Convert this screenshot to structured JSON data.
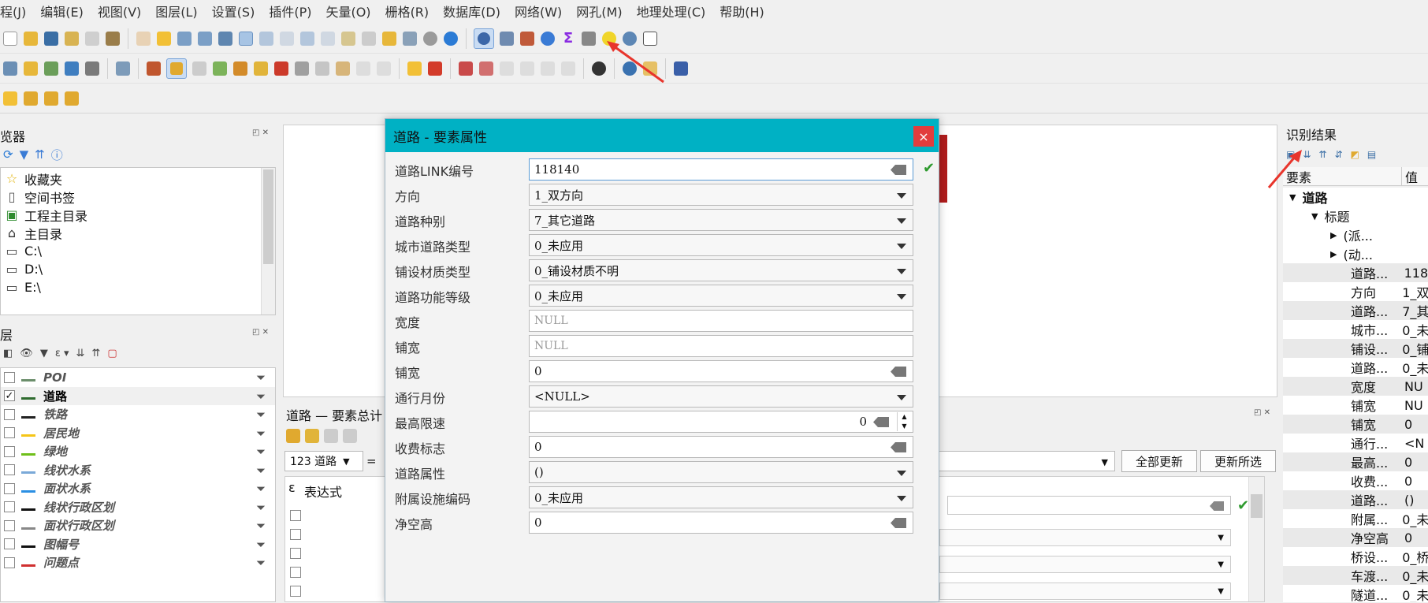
{
  "menubar": [
    "程(J)",
    "编辑(E)",
    "视图(V)",
    "图层(L)",
    "设置(S)",
    "插件(P)",
    "矢量(O)",
    "栅格(R)",
    "数据库(D)",
    "网络(W)",
    "网孔(M)",
    "地理处理(C)",
    "帮助(H)"
  ],
  "browser": {
    "title": "览器",
    "items": [
      {
        "label": "收藏夹",
        "icon": "star-icon"
      },
      {
        "label": "空间书签",
        "icon": "bookmark-icon"
      },
      {
        "label": "工程主目录",
        "icon": "project-home-icon"
      },
      {
        "label": "主目录",
        "icon": "home-icon"
      },
      {
        "label": "C:\\",
        "icon": "folder-icon"
      },
      {
        "label": "D:\\",
        "icon": "folder-icon"
      },
      {
        "label": "E:\\",
        "icon": "folder-icon"
      }
    ]
  },
  "layers": {
    "title": "层",
    "items": [
      {
        "label": "POI",
        "checked": false,
        "symbol": "#6b8e6b"
      },
      {
        "label": "道路",
        "checked": true,
        "symbol": "#2f6b2f"
      },
      {
        "label": "铁路",
        "checked": false,
        "symbol": "#222222"
      },
      {
        "label": "居民地",
        "checked": false,
        "symbol": "#f5c518"
      },
      {
        "label": "绿地",
        "checked": false,
        "symbol": "#6fbf1a"
      },
      {
        "label": "线状水系",
        "checked": false,
        "symbol": "#7aa9d8"
      },
      {
        "label": "面状水系",
        "checked": false,
        "symbol": "#2b8fe3"
      },
      {
        "label": "线状行政区划",
        "checked": false,
        "symbol": "#111111"
      },
      {
        "label": "面状行政区划",
        "checked": false,
        "symbol": "#888888"
      },
      {
        "label": "图幅号",
        "checked": false,
        "symbol": "#111111"
      },
      {
        "label": "问题点",
        "checked": false,
        "symbol": "#d03030"
      }
    ]
  },
  "dialog": {
    "title": "道路 - 要素属性",
    "close": "×",
    "fields": [
      {
        "label": "道路LINK编号",
        "value": "118140",
        "kind": "text"
      },
      {
        "label": "方向",
        "value": "1_双方向",
        "kind": "combo"
      },
      {
        "label": "道路种别",
        "value": "7_其它道路",
        "kind": "combo"
      },
      {
        "label": "城市道路类型",
        "value": "0_未应用",
        "kind": "combo"
      },
      {
        "label": "铺设材质类型",
        "value": "0_铺设材质不明",
        "kind": "combo"
      },
      {
        "label": "道路功能等级",
        "value": "0_未应用",
        "kind": "combo"
      },
      {
        "label": "宽度",
        "value": "NULL",
        "kind": "placeholder"
      },
      {
        "label": "铺宽",
        "value": "NULL",
        "kind": "placeholder"
      },
      {
        "label": "铺宽",
        "value": "0",
        "kind": "text"
      },
      {
        "label": "通行月份",
        "value": "<NULL>",
        "kind": "combo"
      },
      {
        "label": "最高限速",
        "value": "0",
        "kind": "spin"
      },
      {
        "label": "收费标志",
        "value": "0",
        "kind": "text"
      },
      {
        "label": "道路属性",
        "value": "()",
        "kind": "combo"
      },
      {
        "label": "附属设施编码",
        "value": "0_未应用",
        "kind": "combo"
      },
      {
        "label": "净空高",
        "value": "0",
        "kind": "text"
      }
    ]
  },
  "attr_table": {
    "title": "道路 — 要素总计",
    "field_combo": "123 道路",
    "eq": "=",
    "update_all": "全部更新",
    "update_selected": "更新所选",
    "expression": "表达式"
  },
  "identify": {
    "title": "识别结果",
    "col_feature": "要素",
    "col_value": "值",
    "rows": [
      {
        "k": "道路",
        "v": "",
        "level": 0,
        "bold": true,
        "expander": "down"
      },
      {
        "k": "标题",
        "v": "",
        "level": 1,
        "expander": "down"
      },
      {
        "k": "(派...",
        "v": "",
        "level": 2,
        "expander": "right"
      },
      {
        "k": "(动...",
        "v": "",
        "level": 2,
        "expander": "right"
      },
      {
        "k": "道路...",
        "v": "118",
        "level": 3
      },
      {
        "k": "方向",
        "v": "1_双",
        "level": 3
      },
      {
        "k": "道路...",
        "v": "7_其",
        "level": 3
      },
      {
        "k": "城市...",
        "v": "0_未",
        "level": 3
      },
      {
        "k": "铺设...",
        "v": "0_铺",
        "level": 3
      },
      {
        "k": "道路...",
        "v": "0_未",
        "level": 3
      },
      {
        "k": "宽度",
        "v": "NU",
        "level": 3
      },
      {
        "k": "铺宽",
        "v": "NU",
        "level": 3
      },
      {
        "k": "铺宽",
        "v": "0",
        "level": 3
      },
      {
        "k": "通行...",
        "v": "<N",
        "level": 3
      },
      {
        "k": "最高...",
        "v": "0",
        "level": 3
      },
      {
        "k": "收费...",
        "v": "0",
        "level": 3
      },
      {
        "k": "道路...",
        "v": "()",
        "level": 3
      },
      {
        "k": "附属...",
        "v": "0_未",
        "level": 3
      },
      {
        "k": "净空高",
        "v": "0",
        "level": 3
      },
      {
        "k": "桥设...",
        "v": "0_桥",
        "level": 3
      },
      {
        "k": "车渡...",
        "v": "0_未",
        "level": 3
      },
      {
        "k": "隧道...",
        "v": "0_未",
        "level": 3
      }
    ]
  },
  "colors": {
    "dialog_title": "#00b1c4",
    "close": "#e23d3d",
    "arrow": "#e8352c"
  }
}
